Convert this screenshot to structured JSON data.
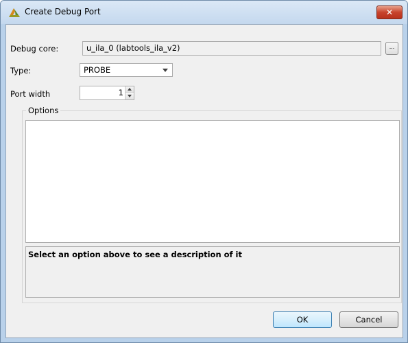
{
  "window": {
    "title": "Create Debug Port",
    "close_label": "✕"
  },
  "form": {
    "debug_core_label": "Debug core:",
    "debug_core_value": "u_ila_0 (labtools_ila_v2)",
    "browse_label": "...",
    "type_label": "Type:",
    "type_value": "PROBE",
    "port_width_label": "Port width",
    "port_width_value": "1"
  },
  "options": {
    "title": "Options",
    "description": "Select an option above to see a description of it"
  },
  "buttons": {
    "ok": "OK",
    "cancel": "Cancel"
  },
  "colors": {
    "title_bar": "#c4d8ee",
    "close_button": "#c7432c",
    "dialog_background": "#f0f0f0"
  }
}
